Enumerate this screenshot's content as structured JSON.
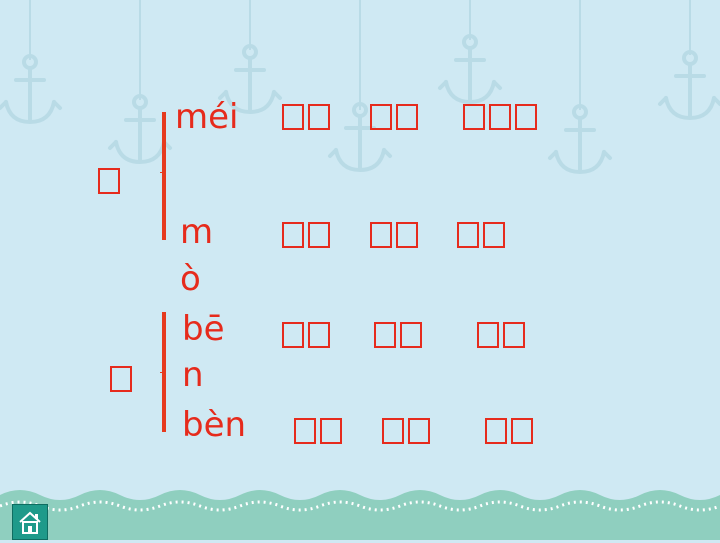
{
  "char1_placeholder": "",
  "char2_placeholder": "",
  "reading1": {
    "pinyin": "méi",
    "words": [
      "",
      "",
      ""
    ]
  },
  "reading2": {
    "pinyin_line1": "m",
    "pinyin_line2": "ò",
    "words": [
      "",
      "",
      ""
    ]
  },
  "reading3": {
    "pinyin": "bē",
    "pinyin_line2": "n",
    "words": [
      "",
      "",
      ""
    ]
  },
  "reading4": {
    "pinyin": "bèn",
    "words": [
      "",
      "",
      ""
    ]
  },
  "colors": {
    "text": "#e62b1c",
    "background": "#cfe9f3",
    "wave": "#8fcfbf",
    "home_button": "#1e9a8a"
  },
  "home_button": {
    "icon": "house-icon"
  }
}
